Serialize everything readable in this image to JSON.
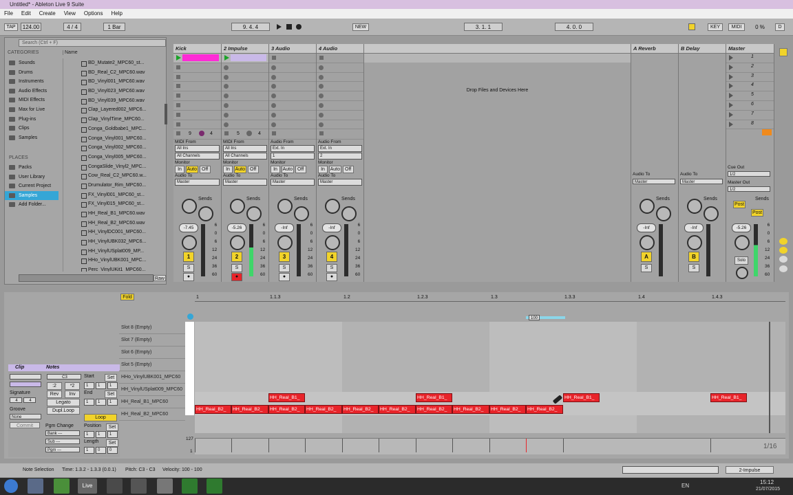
{
  "window": {
    "title": "Untitled* - Ableton Live 9 Suite"
  },
  "menu": [
    "File",
    "Edit",
    "Create",
    "View",
    "Options",
    "Help"
  ],
  "control_bar": {
    "tap": "TAP",
    "tempo": "124.00",
    "signature": "4 / 4",
    "quantize": "1 Bar",
    "position": "9.  4.  4",
    "new": "NEW",
    "loop_start": "3.  1.  1",
    "loop_length": "4.  0.  0",
    "key": "KEY",
    "midi": "MIDI",
    "cpu": "0 %",
    "disk": "D"
  },
  "browser": {
    "search_placeholder": "Search (Ctrl + F)",
    "categories_header": "CATEGORIES",
    "name_header": "Name",
    "categories": [
      "Sounds",
      "Drums",
      "Instruments",
      "Audio Effects",
      "MIDI Effects",
      "Max for Live",
      "Plug-ins",
      "Clips",
      "Samples"
    ],
    "places_header": "PLACES",
    "places": [
      "Packs",
      "User Library",
      "Current Project",
      "Samples",
      "Add Folder..."
    ],
    "files": [
      "BD_Mutate2_MPC60_st...",
      "BD_Real_C2_MPC60.wav",
      "BD_Vinyl001_MPC60.wav",
      "BD_Vinyl023_MPC60.wav",
      "BD_Vinyl039_MPC60.wav",
      "Clap_Layered002_MPC6...",
      "Clap_VinylTime_MPC60...",
      "Conga_Goldbabe1_MPC...",
      "Conga_Vinyl001_MPC60...",
      "Conga_Vinyl002_MPC60...",
      "Conga_Vinyl005_MPC60...",
      "CongaSlide_Vinyl2_MPC...",
      "Cow_Real_C2_MPC60.w...",
      "Drumulator_Rim_MPC60...",
      "FX_Vinyl001_MPC60_st...",
      "FX_Vinyl015_MPC60_st...",
      "HH_Real_B1_MPC60.wav",
      "HH_Real_B2_MPC60.wav",
      "HH_VinylDC001_MPC60...",
      "HH_VinylUBK032_MPC6...",
      "HH_VinylUSplat009_MP...",
      "HHo_VinylUBK001_MPC...",
      "Perc_VinylUKit1_MPC60..."
    ],
    "preview": "Raw"
  },
  "session": {
    "drop_text": "Drop Files and Devices Here",
    "tracks": [
      {
        "name": "Kick",
        "number": "1",
        "volume": "-7.45",
        "stop_num": "9",
        "stop_num2": "4",
        "from_label": "MIDI From",
        "from": "All Ins",
        "channel": "All Channels",
        "to": "Master",
        "color": "#ff2bd6"
      },
      {
        "name": "2 Impulse",
        "number": "2",
        "volume": "-5.26",
        "stop_num": "5",
        "stop_num2": "4",
        "from_label": "MIDI From",
        "from": "All Ins",
        "channel": "All Channels",
        "to": "Master",
        "color": "#c9b9e8"
      },
      {
        "name": "3 Audio",
        "number": "3",
        "volume": "-Inf",
        "from_label": "Audio From",
        "from": "Ext. In",
        "channel": "1",
        "to": "Master"
      },
      {
        "name": "4 Audio",
        "number": "4",
        "volume": "-Inf",
        "from_label": "Audio From",
        "from": "Ext. In",
        "channel": "2",
        "to": "Master"
      }
    ],
    "returns": [
      {
        "name": "A Reverb",
        "letter": "A",
        "volume": "-Inf",
        "to": "Master"
      },
      {
        "name": "B Delay",
        "letter": "B",
        "volume": "-Inf",
        "to": "Master"
      }
    ],
    "master": {
      "name": "Master",
      "scenes": [
        "1",
        "2",
        "3",
        "4",
        "5",
        "6",
        "7",
        "8"
      ],
      "volume": "-5.26",
      "cue_out_label": "Cue Out",
      "cue_out": "1/2",
      "master_out_label": "Master Out",
      "master_out": "1/2",
      "solo": "Solo"
    },
    "monitor_label": "Monitor",
    "monitor": [
      "In",
      "Auto",
      "Off"
    ],
    "audio_to": "Audio To",
    "sends": "Sends",
    "post": "Post",
    "db_scale": [
      "6",
      "0",
      "6",
      "12",
      "24",
      "36",
      "60"
    ]
  },
  "clip_view": {
    "fold": "Fold",
    "clip_title": "Clip",
    "notes_title": "Notes",
    "signature_label": "Signature",
    "sig_num": "4",
    "sig_den": "4",
    "groove_label": "Groove",
    "groove": "None",
    "commit": "Commit",
    "note_name": "C3",
    "start_label": "Start",
    "set": "Set",
    "end_label": "End",
    "rev": "Rev",
    "inv": "Inv",
    "legato": "Legato",
    "dupl_loop": "Dupl.Loop",
    "loop": "Loop",
    "position_label": "Position",
    "length_label": "Length",
    "pgm_change": "Pgm Change",
    "bank": "Bank ---",
    "sub": "Sub ---",
    "pgm": "Pgm ---",
    "div2": ":2",
    "mul2": "*2",
    "start_val": [
      "1",
      "1",
      "1"
    ],
    "end_val": [
      "1",
      "1",
      "1"
    ],
    "pos_val": [
      "1",
      "1",
      "1"
    ],
    "len_val": [
      "1",
      "0",
      "0"
    ],
    "ruler": [
      "1",
      "1.1.3",
      "1.2",
      "1.2.3",
      "1.3",
      "1.3.3",
      "1.4",
      "1.4.3"
    ],
    "velocity_marker": "100",
    "lanes": [
      "Slot 8 (Empty)",
      "Slot 7 (Empty)",
      "Slot 6 (Empty)",
      "Slot 5 (Empty)",
      "HHo_VinylUBK001_MPC60",
      "HH_VinylUSplat009_MPC60",
      "HH_Real_B1_MPC60",
      "HH_Real_B2_MPC60"
    ],
    "note_b1": "HH_Real_B1_",
    "note_b2": "HH_Real_B2_",
    "vel_max": "127",
    "vel_min": "1",
    "grid": "1/16"
  },
  "status": {
    "mode": "Note Selection",
    "time": "Time: 1.3.2 - 1.3.3 (0.0.1)",
    "pitch": "Pitch: C3 - C3",
    "velocity": "Velocity: 100 - 100",
    "track": "2-Impulse"
  },
  "taskbar": {
    "lang": "EN",
    "time": "15:12",
    "date": "21/07/2015",
    "live": "Live"
  }
}
